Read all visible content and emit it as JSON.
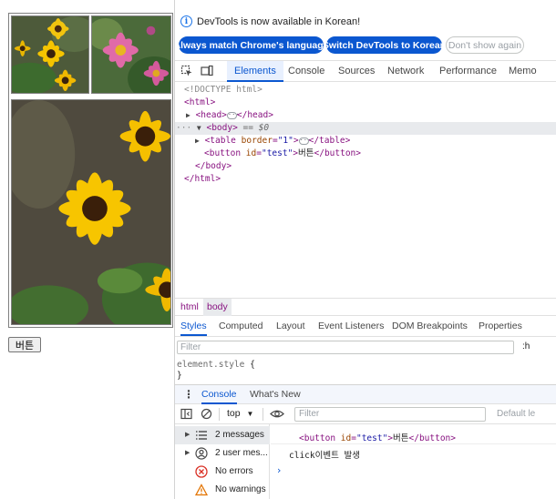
{
  "page": {
    "button_label": "버튼"
  },
  "devtools": {
    "infobar": {
      "message": "DevTools is now available in Korean!",
      "match_language_label": "Always match Chrome's language",
      "switch_label": "Switch DevTools to Korean",
      "dismiss_label": "Don't show again"
    },
    "tabs": [
      "Elements",
      "Console",
      "Sources",
      "Network",
      "Performance",
      "Memo"
    ],
    "active_tab": "Elements",
    "dom": {
      "doctype": "<!DOCTYPE html>",
      "html_open": "<html>",
      "head_open": "<head>",
      "head_close": "</head>",
      "body_open": "<body>",
      "body_marker": "== $0",
      "table_open": "<table",
      "table_attr_name": "border",
      "table_attr_value": "\"1\"",
      "table_close": "</table>",
      "button_open": "<button",
      "button_attr_name": "id",
      "button_attr_value": "\"test\"",
      "button_text": "버튼",
      "button_close": "</button>",
      "body_close": "</body>",
      "html_close": "</html>"
    },
    "breadcrumbs": [
      "html",
      "body"
    ],
    "styles_tabs": [
      "Styles",
      "Computed",
      "Layout",
      "Event Listeners",
      "DOM Breakpoints",
      "Properties"
    ],
    "styles_filter_placeholder": "Filter",
    "hov_label": ":h",
    "element_style_label": "element.style",
    "element_style_open": "{",
    "element_style_close": "}",
    "drawer_tabs": [
      "Console",
      "What's New"
    ],
    "console": {
      "context": "top",
      "filter_placeholder": "Filter",
      "default_levels": "Default le",
      "sidebar": [
        {
          "label": "2 messages",
          "icon": "list-icon"
        },
        {
          "label": "2 user mes...",
          "icon": "user-icon"
        },
        {
          "label": "No errors",
          "icon": "error-icon"
        },
        {
          "label": "No warnings",
          "icon": "warning-icon"
        }
      ],
      "log_line_1": {
        "open": "<button",
        "attr_name": "id",
        "attr_value": "\"test\"",
        "text": "버튼",
        "close": "</button>"
      },
      "log_line_2": "click이벤트 발생",
      "prompt": "›"
    },
    "colors": {
      "accent": "#0b57d0",
      "tag": "#881280",
      "attr_name": "#994500",
      "attr_value": "#1a1aa6",
      "error": "#d93025",
      "warning": "#e37400"
    }
  }
}
